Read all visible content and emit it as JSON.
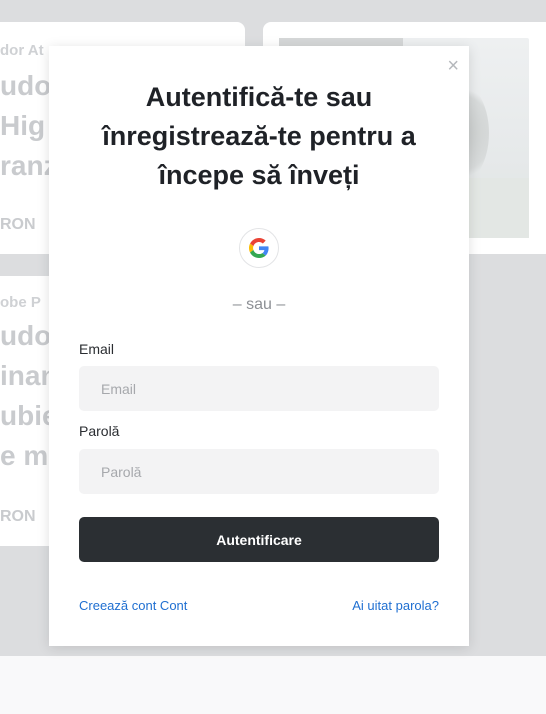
{
  "background": {
    "cards": [
      {
        "category": "dor At",
        "title_lines": [
          "udo",
          "Hig",
          "ranz"
        ],
        "price": "RON"
      },
      {
        "category": "obe P",
        "title_lines": [
          "udo",
          "inan",
          "ubie",
          "e mi"
        ],
        "price": "RON"
      }
    ]
  },
  "modal": {
    "close_symbol": "×",
    "title": "Autentifică-te sau înregistrează-te pentru a începe să înveți",
    "google_icon": "google-icon",
    "divider": "– sau –",
    "email": {
      "label": "Email",
      "placeholder": "Email",
      "value": ""
    },
    "password": {
      "label": "Parolă",
      "placeholder": "Parolă",
      "value": ""
    },
    "submit_label": "Autentificare",
    "create_account_link": "Creează cont Cont",
    "forgot_password_link": "Ai uitat parola?"
  },
  "colors": {
    "primary_button": "#2b2f33",
    "link": "#1f6fd1",
    "overlay": "#dcdddf"
  }
}
